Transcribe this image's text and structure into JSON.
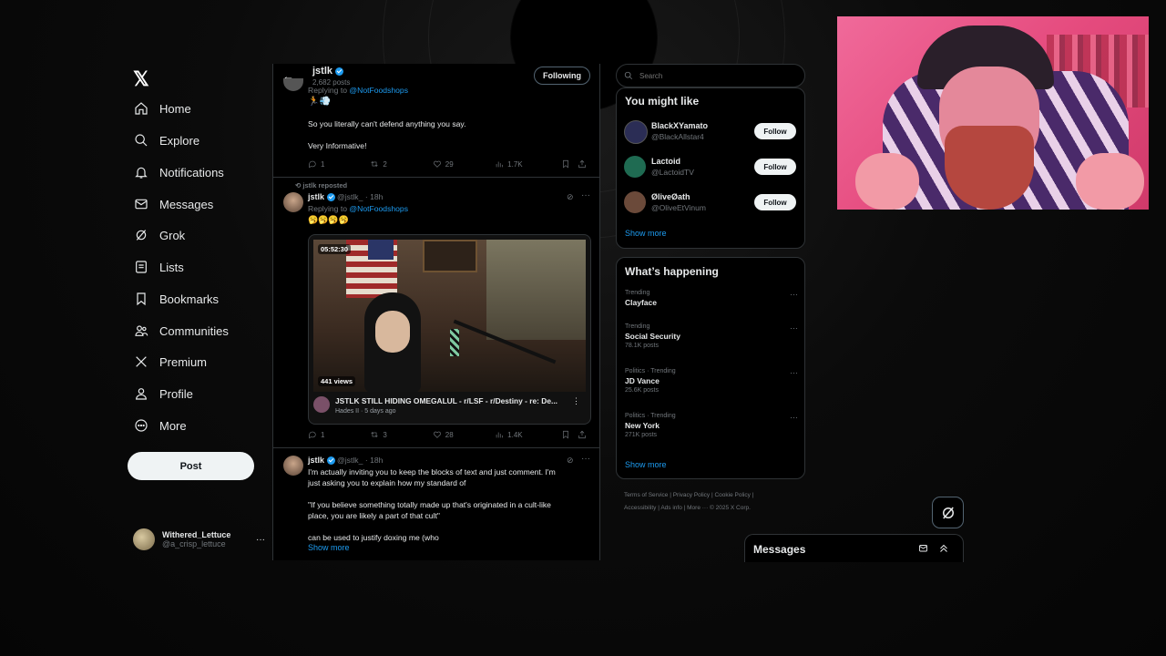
{
  "nav": {
    "logo": "𝕏",
    "items": [
      {
        "label": "Home",
        "icon": "home-icon"
      },
      {
        "label": "Explore",
        "icon": "search-icon"
      },
      {
        "label": "Notifications",
        "icon": "bell-icon"
      },
      {
        "label": "Messages",
        "icon": "envelope-icon"
      },
      {
        "label": "Grok",
        "icon": "grok-icon"
      },
      {
        "label": "Lists",
        "icon": "list-icon"
      },
      {
        "label": "Bookmarks",
        "icon": "bookmark-icon"
      },
      {
        "label": "Communities",
        "icon": "people-icon"
      },
      {
        "label": "Premium",
        "icon": "x-icon"
      },
      {
        "label": "Profile",
        "icon": "person-icon"
      },
      {
        "label": "More",
        "icon": "more-circle-icon"
      }
    ],
    "post_label": "Post",
    "account": {
      "name": "Withered_Lettuce",
      "handle": "@a_crisp_lettuce",
      "more": "···"
    }
  },
  "header": {
    "back": "←",
    "name": "jstlk",
    "posts": "2,682 posts",
    "following_label": "Following"
  },
  "tweets": [
    {
      "replying_prefix": "Replying to ",
      "replying_to": "@NotFoodshops",
      "emoji": "🏃💨",
      "lines": [
        "So you literally can't defend anything you say.",
        "Very Informative!"
      ],
      "stats": {
        "replies": "1",
        "reposts": "2",
        "likes": "29",
        "views": "1.7K"
      }
    },
    {
      "reposted": "jstlk reposted",
      "name": "jstlk",
      "handle": "@jstlk_",
      "time": "· 18h",
      "replying_prefix": "Replying to ",
      "replying_to": "@NotFoodshops",
      "emoji": "🥱🥱🥱🥱",
      "video": {
        "duration": "05:52:30",
        "views": "441 views",
        "title": "JSTLK STILL HIDING OMEGALUL - r/LSF - r/Destiny - re: De...",
        "channel": "Hades II · 5 days ago"
      },
      "stats": {
        "replies": "1",
        "reposts": "3",
        "likes": "28",
        "views": "1.4K"
      }
    },
    {
      "name": "jstlk",
      "handle": "@jstlk_",
      "time": "· 18h",
      "lines": [
        "I'm actually inviting you to keep the blocks of text and just comment. I'm",
        "just asking you to explain how my standard of",
        "\"If you believe something totally made up that's originated in a cult-like",
        "place, you are likely a part of that cult\"",
        "can be used to justify doxing me (who"
      ],
      "show_more": "Show more"
    }
  ],
  "search": {
    "placeholder": "Search"
  },
  "you_might_like": {
    "title": "You might like",
    "accounts": [
      {
        "name": "BlackXYamato",
        "handle": "@BlackAllstar4",
        "follow": "Follow",
        "color": "#2b2d55"
      },
      {
        "name": "Lactoid",
        "handle": "@LactoidTV",
        "follow": "Follow",
        "color": "#1f6b52"
      },
      {
        "name": "ØliveØath",
        "handle": "@OliveEtVinum",
        "follow": "Follow",
        "color": "#6b4a3a"
      }
    ],
    "show_more": "Show more"
  },
  "whats_happening": {
    "title": "What’s happening",
    "trends": [
      {
        "meta": "Trending",
        "name": "Clayface",
        "posts": ""
      },
      {
        "meta": "Trending",
        "name": "Social Security",
        "posts": "78.1K posts"
      },
      {
        "meta": "Politics · Trending",
        "name": "JD Vance",
        "posts": "25.6K posts"
      },
      {
        "meta": "Politics · Trending",
        "name": "New York",
        "posts": "271K posts"
      }
    ],
    "show_more": "Show more"
  },
  "footer": {
    "line1": "Terms of Service  |  Privacy Policy  |  Cookie Policy  |",
    "line2": "Accessibility  |  Ads info  |  More ···  © 2025 X Corp."
  },
  "messages_dock": {
    "title": "Messages"
  },
  "colors": {
    "accent": "#1d9bf0",
    "background": "#000000",
    "border": "#2f3336",
    "muted": "#71767b"
  }
}
